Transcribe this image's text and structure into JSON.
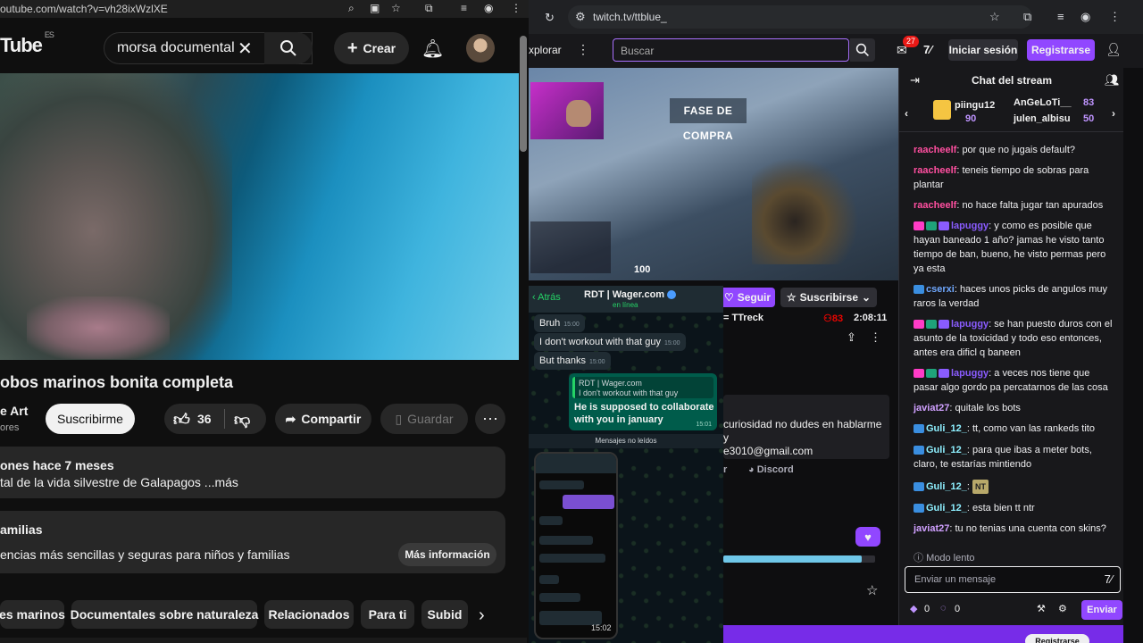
{
  "youtube": {
    "url": "outube.com/watch?v=vh28ixWzlXE",
    "logo": "Tube",
    "logo_region": "ES",
    "search_value": "morsa documental",
    "create_label": "Crear",
    "video_title": "obos marinos bonita completa",
    "channel_name": "e Art",
    "channel_subs": "ores",
    "subscribe_label": "Suscribirme",
    "likes": "36",
    "share_label": "Compartir",
    "save_label": "Guardar",
    "desc_meta": "ones  hace 7 meses",
    "desc_text": "tal de la vida silvestre de Galapagos ...más",
    "info_title": "amilias",
    "info_text": "encias más sencillas y seguras para niños y familias",
    "info_button": "Más información",
    "chips": [
      "es marinos",
      "Documentales sobre naturaleza",
      "Relacionados",
      "Para ti",
      "Subid"
    ]
  },
  "twitch": {
    "url": "twitch.tv/ttblue_",
    "explore_label": "xplorar",
    "search_placeholder": "Buscar",
    "notif_count": "27",
    "login_label": "Iniciar sesión",
    "register_label": "Registrarse",
    "stream_banner": "FASE DE COMPRA",
    "hud_health": "100",
    "follow_label": "Seguir",
    "subscribe_label": "Suscribirse",
    "game": "= TTreck",
    "viewers": "83",
    "uptime": "2:08:11",
    "about_text": "curiosidad no dudes en hablarme y\ne3010@gmail.com",
    "link_r": "r",
    "link_discord": "Discord",
    "progress": 0.91,
    "register_bottom": "Registrarse",
    "chat": {
      "title": "Chat del stream",
      "leaders": [
        {
          "name": "piingu12",
          "points": "90"
        },
        {
          "name": "AnGeLoTi__",
          "points": "83"
        },
        {
          "name": "julen_albisu",
          "points": "50"
        }
      ],
      "messages": [
        {
          "user": "raacheelf",
          "color": "#ff4fa0",
          "text": "por que no jugais default?"
        },
        {
          "user": "raacheelf",
          "color": "#ff4fa0",
          "text": "teneis tiempo de sobras para plantar"
        },
        {
          "user": "raacheelf",
          "color": "#ff4fa0",
          "text": "no hace falta jugar tan apurados"
        },
        {
          "user": "lapuggy",
          "color": "#8a5cff",
          "text": "y como es posible que hayan baneado 1 año? jamas he visto tanto tiempo de ban, bueno, he visto permas pero ya esta"
        },
        {
          "user": "cserxi",
          "color": "#6fa8ff",
          "text": "haces unos picks de angulos muy raros la verdad"
        },
        {
          "user": "lapuggy",
          "color": "#8a5cff",
          "text": "se han puesto duros con el asunto de la toxicidad y todo eso entonces, antes era dificl q baneen"
        },
        {
          "user": "lapuggy",
          "color": "#8a5cff",
          "text": "a veces nos tiene que pasar algo gordo pa percatarnos de las cosa"
        },
        {
          "user": "javiat27",
          "color": "#d0a0ff",
          "text": "quitale los bots"
        },
        {
          "user": "Guli_12_",
          "color": "#8ef0ff",
          "text": "tt, como van las rankeds tito"
        },
        {
          "user": "Guli_12_",
          "color": "#8ef0ff",
          "text": "para que ibas a meter bots, claro, te estarías mintiendo"
        },
        {
          "user": "Guli_12_",
          "color": "#8ef0ff",
          "text": "NT"
        },
        {
          "user": "Guli_12_",
          "color": "#8ef0ff",
          "text": "esta bien tt ntr"
        },
        {
          "user": "javiat27",
          "color": "#d0a0ff",
          "text": "tu no tenias una cuenta con skins?"
        }
      ],
      "slow_mode": "Modo lento",
      "input_placeholder": "Enviar un mensaje",
      "points_a": "0",
      "points_b": "0",
      "send_label": "Enviar"
    }
  },
  "whatsapp": {
    "back_label": "Atrás",
    "contact": "RDT | Wager.com",
    "status": "en línea",
    "messages_in": [
      {
        "text": "Bruh",
        "time": "15:00"
      },
      {
        "text": "I don't workout with that guy",
        "time": "15:00"
      },
      {
        "text": "But thanks",
        "time": "15:00"
      }
    ],
    "reply_quote_name": "RDT | Wager.com",
    "reply_quote_text": "I don't workout with that guy",
    "reply_text": "He is supposed to collaborate with you in january",
    "reply_time": "15:01",
    "unread_label": "Mensajes no leídos",
    "phone_time": "15:02"
  }
}
